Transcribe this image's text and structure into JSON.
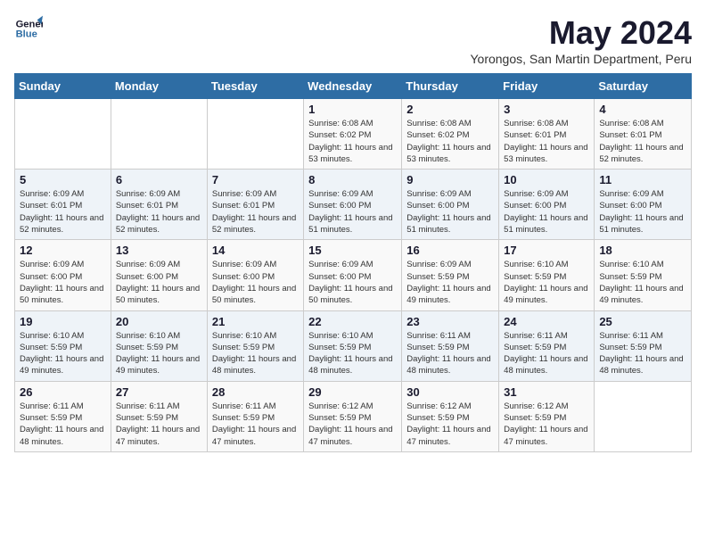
{
  "logo": {
    "line1": "General",
    "line2": "Blue"
  },
  "title": "May 2024",
  "subtitle": "Yorongos, San Martin Department, Peru",
  "days_header": [
    "Sunday",
    "Monday",
    "Tuesday",
    "Wednesday",
    "Thursday",
    "Friday",
    "Saturday"
  ],
  "weeks": [
    [
      {
        "day": "",
        "info": ""
      },
      {
        "day": "",
        "info": ""
      },
      {
        "day": "",
        "info": ""
      },
      {
        "day": "1",
        "info": "Sunrise: 6:08 AM\nSunset: 6:02 PM\nDaylight: 11 hours and 53 minutes."
      },
      {
        "day": "2",
        "info": "Sunrise: 6:08 AM\nSunset: 6:02 PM\nDaylight: 11 hours and 53 minutes."
      },
      {
        "day": "3",
        "info": "Sunrise: 6:08 AM\nSunset: 6:01 PM\nDaylight: 11 hours and 53 minutes."
      },
      {
        "day": "4",
        "info": "Sunrise: 6:08 AM\nSunset: 6:01 PM\nDaylight: 11 hours and 52 minutes."
      }
    ],
    [
      {
        "day": "5",
        "info": "Sunrise: 6:09 AM\nSunset: 6:01 PM\nDaylight: 11 hours and 52 minutes."
      },
      {
        "day": "6",
        "info": "Sunrise: 6:09 AM\nSunset: 6:01 PM\nDaylight: 11 hours and 52 minutes."
      },
      {
        "day": "7",
        "info": "Sunrise: 6:09 AM\nSunset: 6:01 PM\nDaylight: 11 hours and 52 minutes."
      },
      {
        "day": "8",
        "info": "Sunrise: 6:09 AM\nSunset: 6:00 PM\nDaylight: 11 hours and 51 minutes."
      },
      {
        "day": "9",
        "info": "Sunrise: 6:09 AM\nSunset: 6:00 PM\nDaylight: 11 hours and 51 minutes."
      },
      {
        "day": "10",
        "info": "Sunrise: 6:09 AM\nSunset: 6:00 PM\nDaylight: 11 hours and 51 minutes."
      },
      {
        "day": "11",
        "info": "Sunrise: 6:09 AM\nSunset: 6:00 PM\nDaylight: 11 hours and 51 minutes."
      }
    ],
    [
      {
        "day": "12",
        "info": "Sunrise: 6:09 AM\nSunset: 6:00 PM\nDaylight: 11 hours and 50 minutes."
      },
      {
        "day": "13",
        "info": "Sunrise: 6:09 AM\nSunset: 6:00 PM\nDaylight: 11 hours and 50 minutes."
      },
      {
        "day": "14",
        "info": "Sunrise: 6:09 AM\nSunset: 6:00 PM\nDaylight: 11 hours and 50 minutes."
      },
      {
        "day": "15",
        "info": "Sunrise: 6:09 AM\nSunset: 6:00 PM\nDaylight: 11 hours and 50 minutes."
      },
      {
        "day": "16",
        "info": "Sunrise: 6:09 AM\nSunset: 5:59 PM\nDaylight: 11 hours and 49 minutes."
      },
      {
        "day": "17",
        "info": "Sunrise: 6:10 AM\nSunset: 5:59 PM\nDaylight: 11 hours and 49 minutes."
      },
      {
        "day": "18",
        "info": "Sunrise: 6:10 AM\nSunset: 5:59 PM\nDaylight: 11 hours and 49 minutes."
      }
    ],
    [
      {
        "day": "19",
        "info": "Sunrise: 6:10 AM\nSunset: 5:59 PM\nDaylight: 11 hours and 49 minutes."
      },
      {
        "day": "20",
        "info": "Sunrise: 6:10 AM\nSunset: 5:59 PM\nDaylight: 11 hours and 49 minutes."
      },
      {
        "day": "21",
        "info": "Sunrise: 6:10 AM\nSunset: 5:59 PM\nDaylight: 11 hours and 48 minutes."
      },
      {
        "day": "22",
        "info": "Sunrise: 6:10 AM\nSunset: 5:59 PM\nDaylight: 11 hours and 48 minutes."
      },
      {
        "day": "23",
        "info": "Sunrise: 6:11 AM\nSunset: 5:59 PM\nDaylight: 11 hours and 48 minutes."
      },
      {
        "day": "24",
        "info": "Sunrise: 6:11 AM\nSunset: 5:59 PM\nDaylight: 11 hours and 48 minutes."
      },
      {
        "day": "25",
        "info": "Sunrise: 6:11 AM\nSunset: 5:59 PM\nDaylight: 11 hours and 48 minutes."
      }
    ],
    [
      {
        "day": "26",
        "info": "Sunrise: 6:11 AM\nSunset: 5:59 PM\nDaylight: 11 hours and 48 minutes."
      },
      {
        "day": "27",
        "info": "Sunrise: 6:11 AM\nSunset: 5:59 PM\nDaylight: 11 hours and 47 minutes."
      },
      {
        "day": "28",
        "info": "Sunrise: 6:11 AM\nSunset: 5:59 PM\nDaylight: 11 hours and 47 minutes."
      },
      {
        "day": "29",
        "info": "Sunrise: 6:12 AM\nSunset: 5:59 PM\nDaylight: 11 hours and 47 minutes."
      },
      {
        "day": "30",
        "info": "Sunrise: 6:12 AM\nSunset: 5:59 PM\nDaylight: 11 hours and 47 minutes."
      },
      {
        "day": "31",
        "info": "Sunrise: 6:12 AM\nSunset: 5:59 PM\nDaylight: 11 hours and 47 minutes."
      },
      {
        "day": "",
        "info": ""
      }
    ]
  ]
}
